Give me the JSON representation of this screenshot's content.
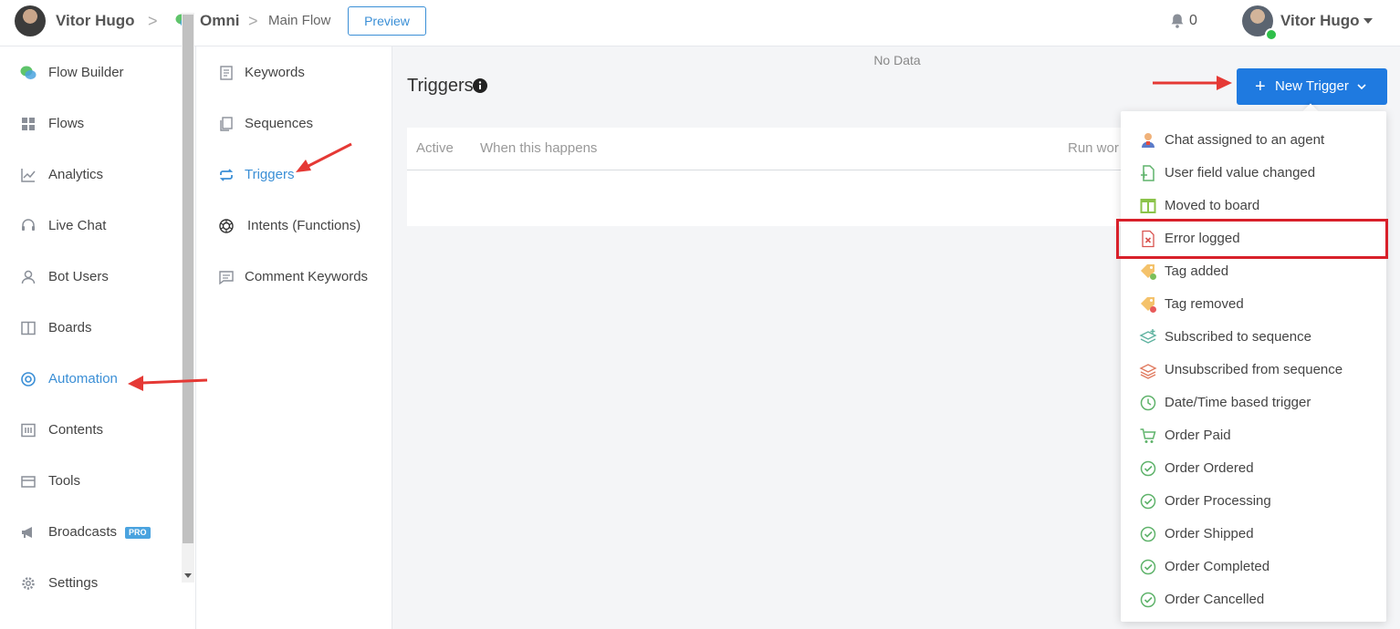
{
  "topbar": {
    "user_name": "Vitor Hugo",
    "separator": ">",
    "workspace": "Omni",
    "flow": "Main Flow",
    "preview_label": "Preview",
    "notifications_count": "0",
    "account_name": "Vitor Hugo"
  },
  "sidebar": {
    "items": [
      {
        "label": "Flow Builder",
        "icon": "chat-bubbles-icon"
      },
      {
        "label": "Flows",
        "icon": "grid-icon"
      },
      {
        "label": "Analytics",
        "icon": "chart-icon"
      },
      {
        "label": "Live Chat",
        "icon": "headset-icon"
      },
      {
        "label": "Bot Users",
        "icon": "user-icon"
      },
      {
        "label": "Boards",
        "icon": "board-icon"
      },
      {
        "label": "Automation",
        "icon": "lifebuoy-icon",
        "active": true
      },
      {
        "label": "Contents",
        "icon": "content-icon"
      },
      {
        "label": "Tools",
        "icon": "toolbox-icon"
      },
      {
        "label": "Broadcasts",
        "icon": "megaphone-icon",
        "badge": "PRO"
      },
      {
        "label": "Settings",
        "icon": "gear-icon"
      }
    ]
  },
  "subnav": {
    "items": [
      {
        "label": "Keywords",
        "icon": "document-icon"
      },
      {
        "label": "Sequences",
        "icon": "copy-icon"
      },
      {
        "label": "Triggers",
        "icon": "repeat-icon",
        "active": true
      },
      {
        "label": "Intents (Functions)",
        "icon": "openai-icon"
      },
      {
        "label": "Comment Keywords",
        "icon": "comment-icon"
      }
    ]
  },
  "main": {
    "title": "Triggers",
    "table": {
      "columns": [
        "Active",
        "When this happens",
        "Run wor"
      ],
      "empty_text": "No Data"
    },
    "new_trigger_label": "New Trigger",
    "accent_color": "#1f7ae0"
  },
  "dropdown": {
    "items": [
      {
        "label": "Chat assigned to an agent",
        "icon": "agent-icon"
      },
      {
        "label": "User field value changed",
        "icon": "file-edit-icon"
      },
      {
        "label": "Moved to board",
        "icon": "board-move-icon"
      },
      {
        "label": "Error logged",
        "icon": "error-file-icon",
        "highlighted": true
      },
      {
        "label": "Tag added",
        "icon": "tag-add-icon"
      },
      {
        "label": "Tag removed",
        "icon": "tag-remove-icon"
      },
      {
        "label": "Subscribed to sequence",
        "icon": "stack-add-icon"
      },
      {
        "label": "Unsubscribed from sequence",
        "icon": "stack-remove-icon"
      },
      {
        "label": "Date/Time based trigger",
        "icon": "clock-icon"
      },
      {
        "label": "Order Paid",
        "icon": "cart-icon"
      },
      {
        "label": "Order Ordered",
        "icon": "check-circle-icon"
      },
      {
        "label": "Order Processing",
        "icon": "check-circle-icon"
      },
      {
        "label": "Order Shipped",
        "icon": "check-circle-icon"
      },
      {
        "label": "Order Completed",
        "icon": "check-circle-icon"
      },
      {
        "label": "Order Cancelled",
        "icon": "check-circle-icon"
      }
    ]
  }
}
